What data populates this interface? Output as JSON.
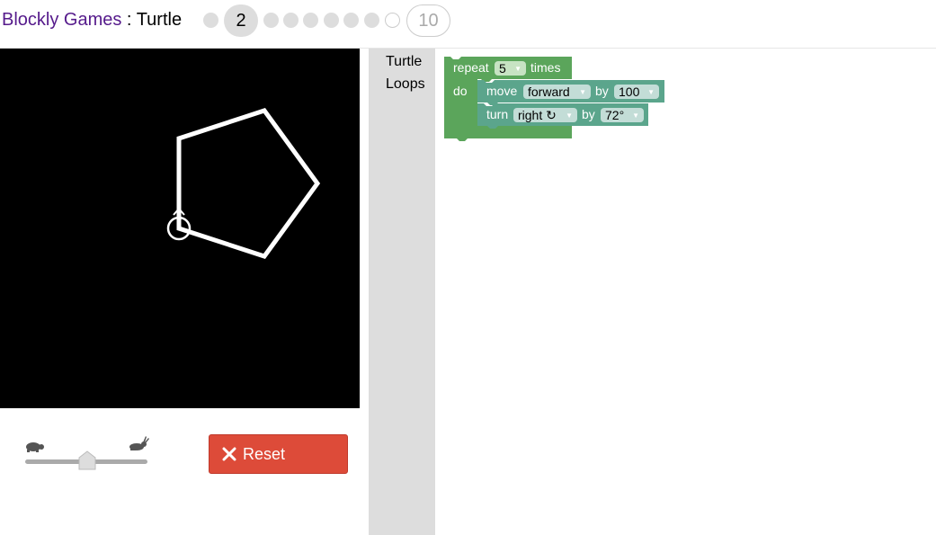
{
  "header": {
    "site_link": "Blockly Games",
    "separator": " : ",
    "game_name": "Turtle",
    "current_level": "2",
    "last_level": "10"
  },
  "toolbox": {
    "categories": [
      "Turtle",
      "Loops"
    ]
  },
  "blocks": {
    "repeat": {
      "label": "repeat",
      "count": "5",
      "suffix": "times",
      "do_label": "do"
    },
    "move": {
      "label": "move",
      "direction": "forward",
      "by_label": "by",
      "distance": "100"
    },
    "turn": {
      "label": "turn",
      "direction": "right ↻",
      "by_label": "by",
      "angle": "72°"
    }
  },
  "controls": {
    "reset_label": "Reset",
    "speed": 0.5
  },
  "colors": {
    "loop_block": "#5ba55b",
    "turtle_block": "#5ba58c",
    "reset_button": "#dd4b39",
    "link": "#551a8b"
  },
  "icons": {
    "slow": "turtle-icon",
    "fast": "rabbit-icon",
    "reset": "close-icon",
    "dropdown": "dropdown-arrow-icon"
  }
}
